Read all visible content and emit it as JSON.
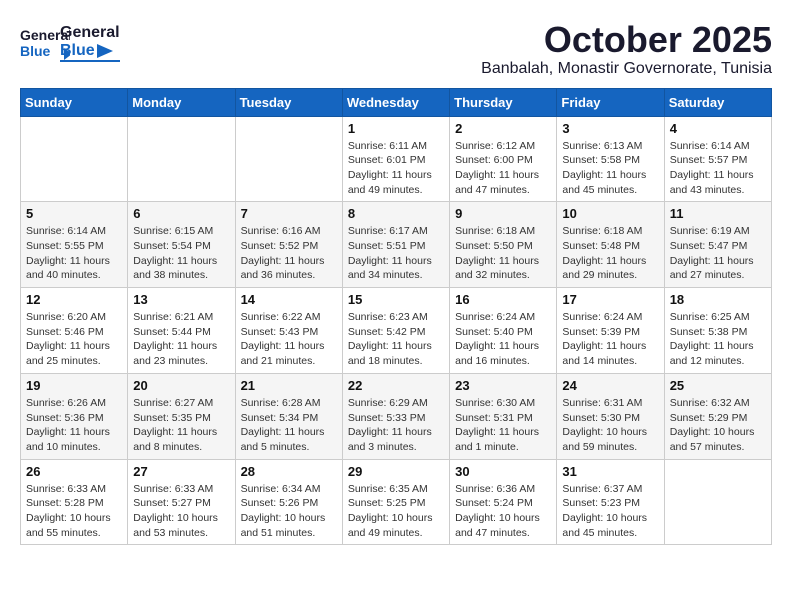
{
  "header": {
    "logo_general": "General",
    "logo_blue": "Blue",
    "title": "October 2025",
    "subtitle": "Banbalah, Monastir Governorate, Tunisia"
  },
  "days_of_week": [
    "Sunday",
    "Monday",
    "Tuesday",
    "Wednesday",
    "Thursday",
    "Friday",
    "Saturday"
  ],
  "weeks": [
    [
      {
        "day": "",
        "info": ""
      },
      {
        "day": "",
        "info": ""
      },
      {
        "day": "",
        "info": ""
      },
      {
        "day": "1",
        "info": "Sunrise: 6:11 AM\nSunset: 6:01 PM\nDaylight: 11 hours\nand 49 minutes."
      },
      {
        "day": "2",
        "info": "Sunrise: 6:12 AM\nSunset: 6:00 PM\nDaylight: 11 hours\nand 47 minutes."
      },
      {
        "day": "3",
        "info": "Sunrise: 6:13 AM\nSunset: 5:58 PM\nDaylight: 11 hours\nand 45 minutes."
      },
      {
        "day": "4",
        "info": "Sunrise: 6:14 AM\nSunset: 5:57 PM\nDaylight: 11 hours\nand 43 minutes."
      }
    ],
    [
      {
        "day": "5",
        "info": "Sunrise: 6:14 AM\nSunset: 5:55 PM\nDaylight: 11 hours\nand 40 minutes."
      },
      {
        "day": "6",
        "info": "Sunrise: 6:15 AM\nSunset: 5:54 PM\nDaylight: 11 hours\nand 38 minutes."
      },
      {
        "day": "7",
        "info": "Sunrise: 6:16 AM\nSunset: 5:52 PM\nDaylight: 11 hours\nand 36 minutes."
      },
      {
        "day": "8",
        "info": "Sunrise: 6:17 AM\nSunset: 5:51 PM\nDaylight: 11 hours\nand 34 minutes."
      },
      {
        "day": "9",
        "info": "Sunrise: 6:18 AM\nSunset: 5:50 PM\nDaylight: 11 hours\nand 32 minutes."
      },
      {
        "day": "10",
        "info": "Sunrise: 6:18 AM\nSunset: 5:48 PM\nDaylight: 11 hours\nand 29 minutes."
      },
      {
        "day": "11",
        "info": "Sunrise: 6:19 AM\nSunset: 5:47 PM\nDaylight: 11 hours\nand 27 minutes."
      }
    ],
    [
      {
        "day": "12",
        "info": "Sunrise: 6:20 AM\nSunset: 5:46 PM\nDaylight: 11 hours\nand 25 minutes."
      },
      {
        "day": "13",
        "info": "Sunrise: 6:21 AM\nSunset: 5:44 PM\nDaylight: 11 hours\nand 23 minutes."
      },
      {
        "day": "14",
        "info": "Sunrise: 6:22 AM\nSunset: 5:43 PM\nDaylight: 11 hours\nand 21 minutes."
      },
      {
        "day": "15",
        "info": "Sunrise: 6:23 AM\nSunset: 5:42 PM\nDaylight: 11 hours\nand 18 minutes."
      },
      {
        "day": "16",
        "info": "Sunrise: 6:24 AM\nSunset: 5:40 PM\nDaylight: 11 hours\nand 16 minutes."
      },
      {
        "day": "17",
        "info": "Sunrise: 6:24 AM\nSunset: 5:39 PM\nDaylight: 11 hours\nand 14 minutes."
      },
      {
        "day": "18",
        "info": "Sunrise: 6:25 AM\nSunset: 5:38 PM\nDaylight: 11 hours\nand 12 minutes."
      }
    ],
    [
      {
        "day": "19",
        "info": "Sunrise: 6:26 AM\nSunset: 5:36 PM\nDaylight: 11 hours\nand 10 minutes."
      },
      {
        "day": "20",
        "info": "Sunrise: 6:27 AM\nSunset: 5:35 PM\nDaylight: 11 hours\nand 8 minutes."
      },
      {
        "day": "21",
        "info": "Sunrise: 6:28 AM\nSunset: 5:34 PM\nDaylight: 11 hours\nand 5 minutes."
      },
      {
        "day": "22",
        "info": "Sunrise: 6:29 AM\nSunset: 5:33 PM\nDaylight: 11 hours\nand 3 minutes."
      },
      {
        "day": "23",
        "info": "Sunrise: 6:30 AM\nSunset: 5:31 PM\nDaylight: 11 hours\nand 1 minute."
      },
      {
        "day": "24",
        "info": "Sunrise: 6:31 AM\nSunset: 5:30 PM\nDaylight: 10 hours\nand 59 minutes."
      },
      {
        "day": "25",
        "info": "Sunrise: 6:32 AM\nSunset: 5:29 PM\nDaylight: 10 hours\nand 57 minutes."
      }
    ],
    [
      {
        "day": "26",
        "info": "Sunrise: 6:33 AM\nSunset: 5:28 PM\nDaylight: 10 hours\nand 55 minutes."
      },
      {
        "day": "27",
        "info": "Sunrise: 6:33 AM\nSunset: 5:27 PM\nDaylight: 10 hours\nand 53 minutes."
      },
      {
        "day": "28",
        "info": "Sunrise: 6:34 AM\nSunset: 5:26 PM\nDaylight: 10 hours\nand 51 minutes."
      },
      {
        "day": "29",
        "info": "Sunrise: 6:35 AM\nSunset: 5:25 PM\nDaylight: 10 hours\nand 49 minutes."
      },
      {
        "day": "30",
        "info": "Sunrise: 6:36 AM\nSunset: 5:24 PM\nDaylight: 10 hours\nand 47 minutes."
      },
      {
        "day": "31",
        "info": "Sunrise: 6:37 AM\nSunset: 5:23 PM\nDaylight: 10 hours\nand 45 minutes."
      },
      {
        "day": "",
        "info": ""
      }
    ]
  ]
}
